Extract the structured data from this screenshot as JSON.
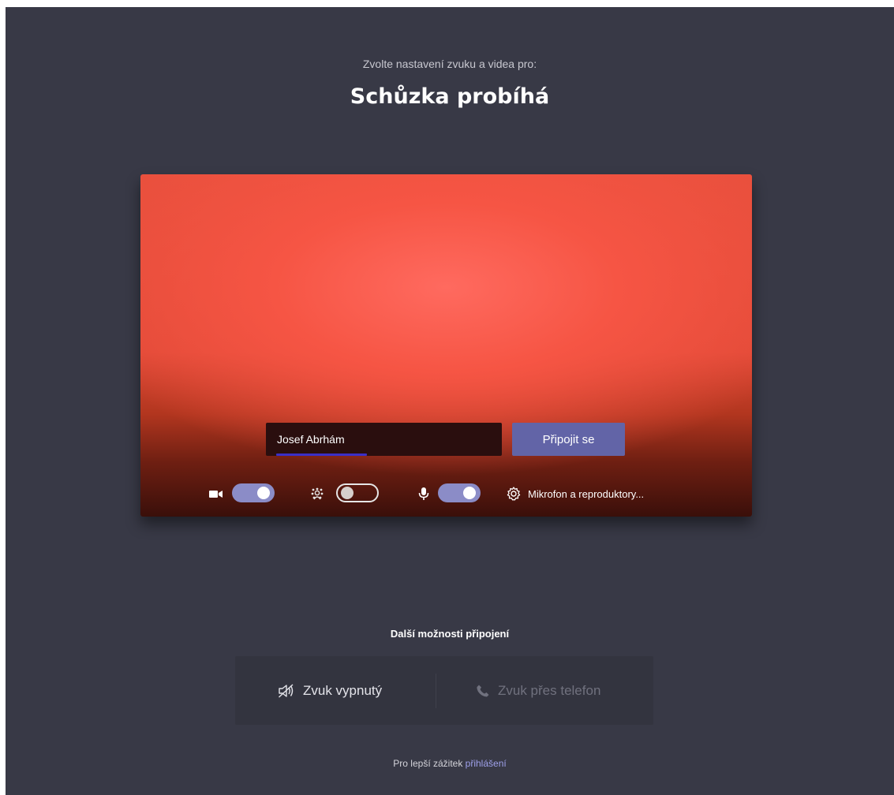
{
  "header": {
    "subtitle": "Zvolte nastavení zvuku a videa pro:",
    "meeting_title": "Schůzka probíhá"
  },
  "preview": {
    "name_value": "Josef Abrhám",
    "join_label": "Připojit se",
    "controls": {
      "camera": {
        "icon": "video-camera-icon",
        "on": true
      },
      "background_blur": {
        "icon": "background-blur-icon",
        "on": false
      },
      "microphone": {
        "icon": "microphone-icon",
        "on": true
      },
      "device_settings_label": "Mikrofon a reproduktory..."
    }
  },
  "other_options": {
    "heading": "Další možnosti připojení",
    "audio_off_label": "Zvuk vypnutý",
    "phone_audio_label": "Zvuk přes telefon"
  },
  "footer": {
    "text": "Pro lepší zážitek ",
    "link": "přihlášení"
  },
  "colors": {
    "background": "#383946",
    "accent": "#6264a7",
    "toggle_on": "#8b8cc7",
    "link": "#9ea0ea"
  }
}
